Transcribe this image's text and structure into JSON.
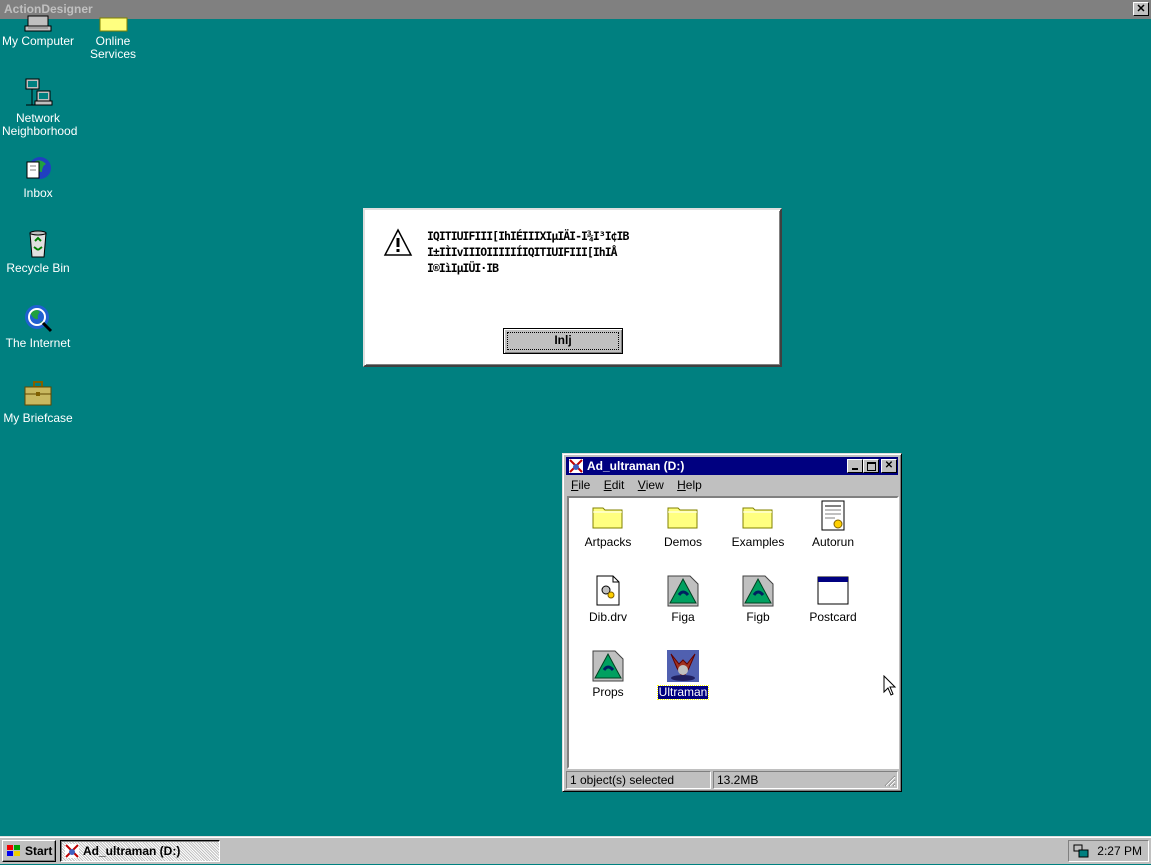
{
  "app_bar": {
    "title": "ActionDesigner",
    "close_glyph": "✕"
  },
  "desktop": {
    "icons": [
      {
        "label": "My Computer",
        "icon": "computer-icon"
      },
      {
        "label": "Online Services",
        "icon": "folder-icon"
      },
      {
        "label": "Network Neighborhood",
        "icon": "network-icon"
      },
      {
        "label": "Inbox",
        "icon": "inbox-icon"
      },
      {
        "label": "Recycle Bin",
        "icon": "recycle-bin-icon"
      },
      {
        "label": "The Internet",
        "icon": "internet-icon"
      },
      {
        "label": "My Briefcase",
        "icon": "briefcase-icon"
      }
    ]
  },
  "dialog": {
    "icon": "warning-icon",
    "lines": [
      "IQITIUIFIII[IhIÉIIIXIµIÄI-I¾I³I¢IB",
      "I±IÌIvIIIOIIIIIÍIQITIUIFIII[IhIÅ",
      "I®IìIµIÜI·IB"
    ],
    "ok_label": "Inlj"
  },
  "explorer": {
    "title": "Ad_ultraman (D:)",
    "menu": [
      {
        "label": "File",
        "key": "F",
        "rest": "ile"
      },
      {
        "label": "Edit",
        "key": "E",
        "rest": "dit"
      },
      {
        "label": "View",
        "key": "V",
        "rest": "iew"
      },
      {
        "label": "Help",
        "key": "H",
        "rest": "elp"
      }
    ],
    "files": [
      {
        "label": "Artpacks",
        "icon": "folder-icon"
      },
      {
        "label": "Demos",
        "icon": "folder-icon"
      },
      {
        "label": "Examples",
        "icon": "folder-icon"
      },
      {
        "label": "Autorun",
        "icon": "autorun-icon"
      },
      {
        "label": "Dib.drv",
        "icon": "driver-icon"
      },
      {
        "label": "Figa",
        "icon": "actiondesigner-file-icon"
      },
      {
        "label": "Figb",
        "icon": "actiondesigner-file-icon"
      },
      {
        "label": "Postcard",
        "icon": "window-app-icon"
      },
      {
        "label": "Props",
        "icon": "actiondesigner-file-icon"
      },
      {
        "label": "Ultraman",
        "icon": "ultraman-icon",
        "selected": true
      }
    ],
    "status": {
      "selection": "1 object(s) selected",
      "size": "13.2MB"
    }
  },
  "taskbar": {
    "start_label": "Start",
    "task_label": "Ad_ultraman (D:)",
    "clock": "2:27 PM"
  },
  "colors": {
    "desktop": "#008080",
    "title_active": "#000080",
    "title_inactive": "#808080",
    "face": "#c0c0c0"
  }
}
